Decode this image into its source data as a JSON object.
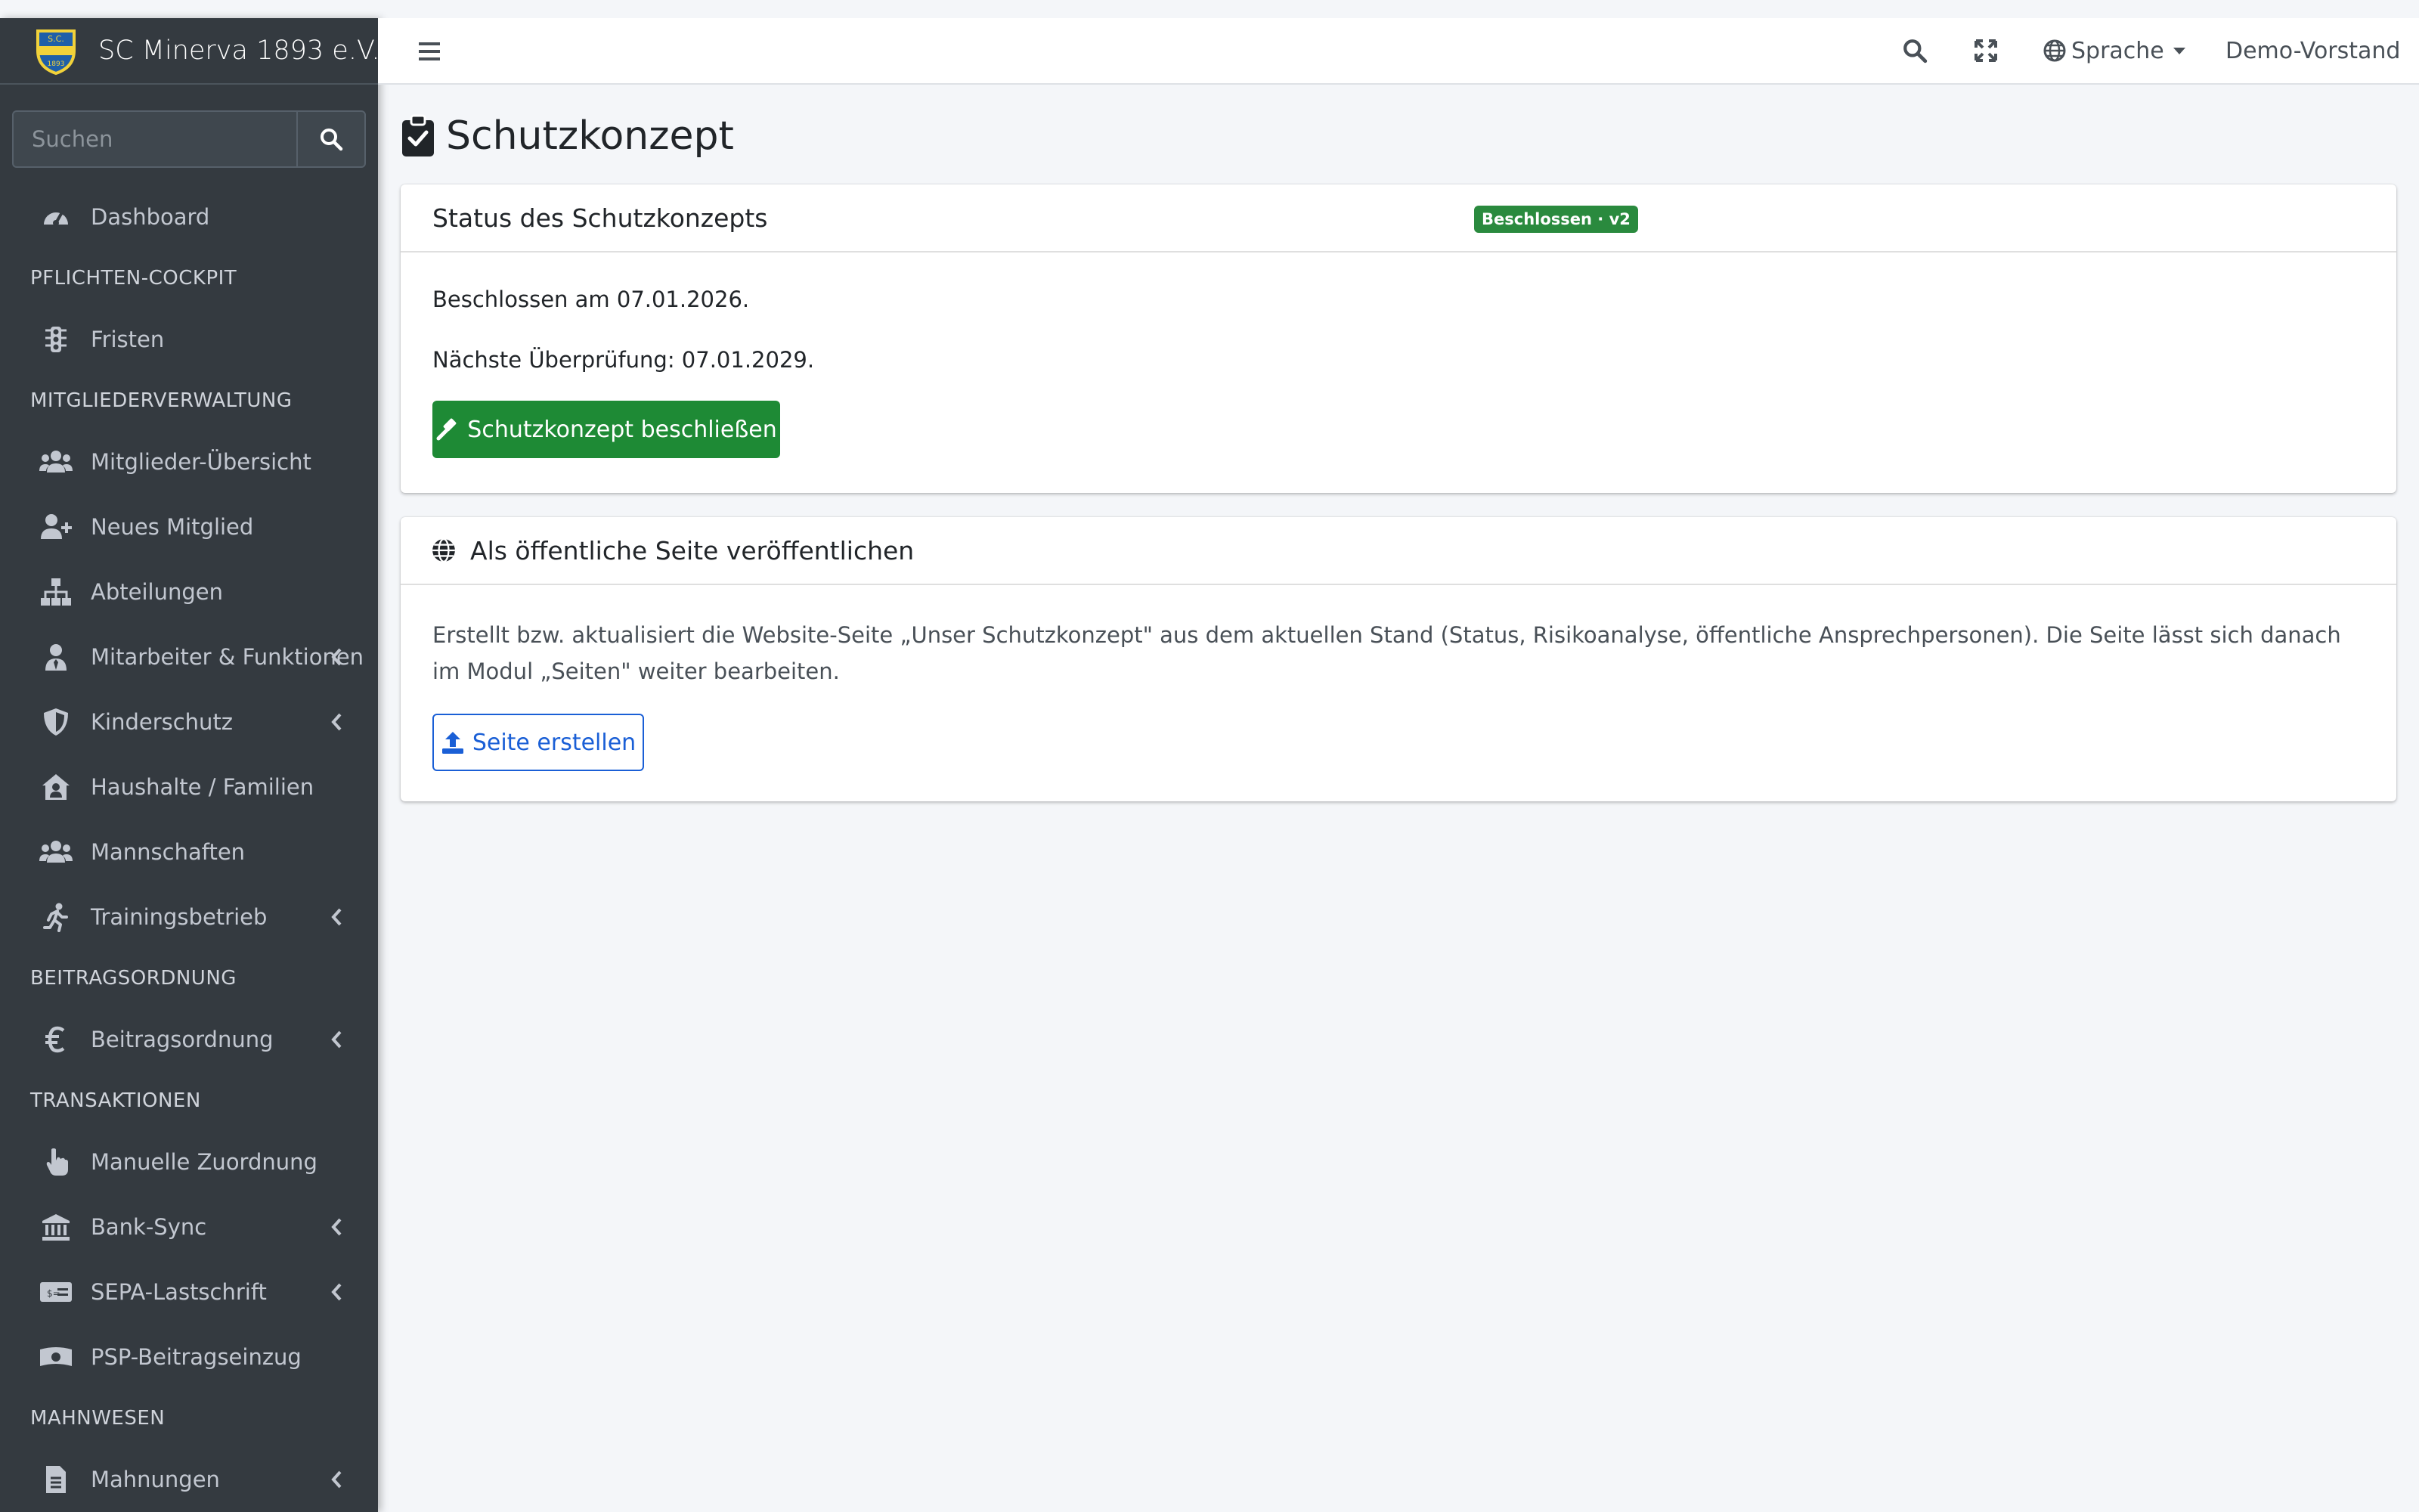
{
  "brand": {
    "name": "SC Minerva 1893 e.V."
  },
  "search": {
    "placeholder": "Suchen"
  },
  "sidebar": {
    "dashboard": "Dashboard",
    "section_pflichten": "PFLICHTEN-COCKPIT",
    "fristen": "Fristen",
    "section_mitglieder": "MITGLIEDERVERWALTUNG",
    "mitglieder_uebersicht": "Mitglieder-Übersicht",
    "neues_mitglied": "Neues Mitglied",
    "abteilungen": "Abteilungen",
    "mitarbeiter": "Mitarbeiter & Funktionen",
    "kinderschutz": "Kinderschutz",
    "haushalte": "Haushalte / Familien",
    "mannschaften": "Mannschaften",
    "trainingsbetrieb": "Trainingsbetrieb",
    "section_beitrag": "BEITRAGSORDNUNG",
    "beitragsordnung": "Beitragsordnung",
    "section_transaktionen": "TRANSAKTIONEN",
    "manuelle_zuordnung": "Manuelle Zuordnung",
    "bank_sync": "Bank-Sync",
    "sepa": "SEPA-Lastschrift",
    "psp": "PSP-Beitragseinzug",
    "section_mahnwesen": "MAHNWESEN",
    "mahnungen": "Mahnungen"
  },
  "navbar": {
    "language": "Sprache",
    "user": "Demo-Vorstand"
  },
  "page": {
    "title": "Schutzkonzept"
  },
  "status_card": {
    "title": "Status des Schutzkonzepts",
    "badge": "Beschlossen · v2",
    "decided": "Beschlossen am 07.01.2026.",
    "next_review": "Nächste Überprüfung: 07.01.2029.",
    "button": "Schutzkonzept beschließen"
  },
  "publish_card": {
    "title": "Als öffentliche Seite veröffentlichen",
    "description": "Erstellt bzw. aktualisiert die Website-Seite „Unser Schutzkonzept\" aus dem aktuellen Stand (Status, Risikoanalyse, öffentliche Ansprechpersonen). Die Seite lässt sich danach im Modul „Seiten\" weiter bearbeiten.",
    "button": "Seite erstellen"
  },
  "colors": {
    "sidebar": "#343a40",
    "success": "#1e8a35",
    "primary": "#1a5fd6"
  }
}
